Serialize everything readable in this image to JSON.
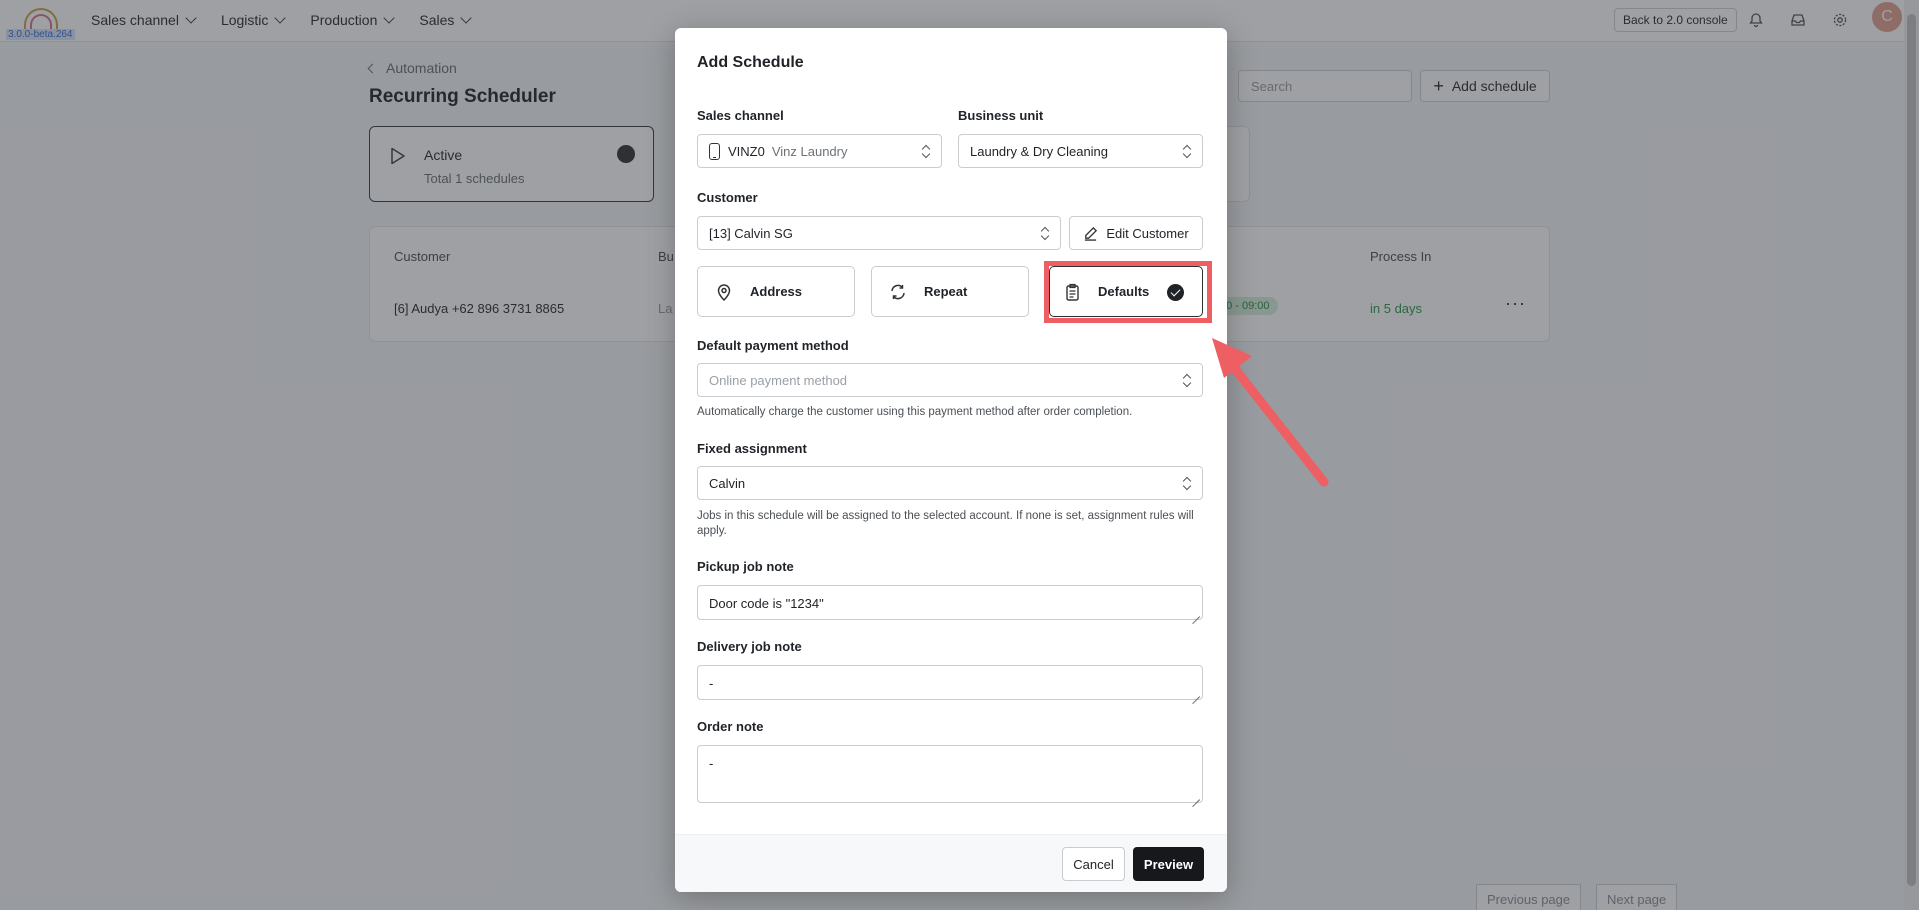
{
  "topbar": {
    "logo_version": "3.0.0-beta.264",
    "nav": [
      {
        "label": "Sales channel"
      },
      {
        "label": "Logistic"
      },
      {
        "label": "Production"
      },
      {
        "label": "Sales"
      }
    ],
    "console_button": "Back to 2.0 console",
    "avatar_initial": "C"
  },
  "page": {
    "breadcrumb": "Automation",
    "title": "Recurring Scheduler",
    "search_placeholder": "Search",
    "add_schedule": "Add schedule",
    "status_card": {
      "label": "Active",
      "sub": "Total 1 schedules"
    },
    "table": {
      "headers": {
        "customer": "Customer",
        "business_unit": "Bu",
        "process_in": "Process In"
      },
      "row": {
        "customer": "[6] Audya +62 896 3731 8865",
        "business_unit": "La",
        "time": "00 - 09:00",
        "process_in": "in 5 days"
      }
    },
    "pager": {
      "prev": "Previous page",
      "next": "Next page"
    }
  },
  "modal": {
    "title": "Add Schedule",
    "sales_channel": {
      "label": "Sales channel",
      "code": "VINZ0",
      "name": "Vinz Laundry"
    },
    "business_unit": {
      "label": "Business unit",
      "value": "Laundry & Dry Cleaning"
    },
    "customer": {
      "label": "Customer",
      "value": "[13] Calvin SG",
      "edit_button": "Edit Customer"
    },
    "tiles": [
      {
        "label": "Address",
        "icon": "map-pin-icon"
      },
      {
        "label": "Repeat",
        "icon": "repeat-icon"
      },
      {
        "label": "Defaults",
        "icon": "clipboard-icon",
        "selected": true
      }
    ],
    "payment": {
      "label": "Default payment method",
      "placeholder": "Online payment method",
      "help": "Automatically charge the customer using this payment method after order completion."
    },
    "assignment": {
      "label": "Fixed assignment",
      "value": "Calvin",
      "help": "Jobs in this schedule will be assigned to the selected account. If none is set, assignment rules will apply."
    },
    "pickup_note": {
      "label": "Pickup job note",
      "value": "Door code is \"1234\""
    },
    "delivery_note": {
      "label": "Delivery job note",
      "value": "-"
    },
    "order_note": {
      "label": "Order note",
      "value": "-"
    },
    "cancel": "Cancel",
    "preview": "Preview"
  },
  "colors": {
    "highlight": "#ee5f63",
    "primary_button": "#16181b"
  }
}
